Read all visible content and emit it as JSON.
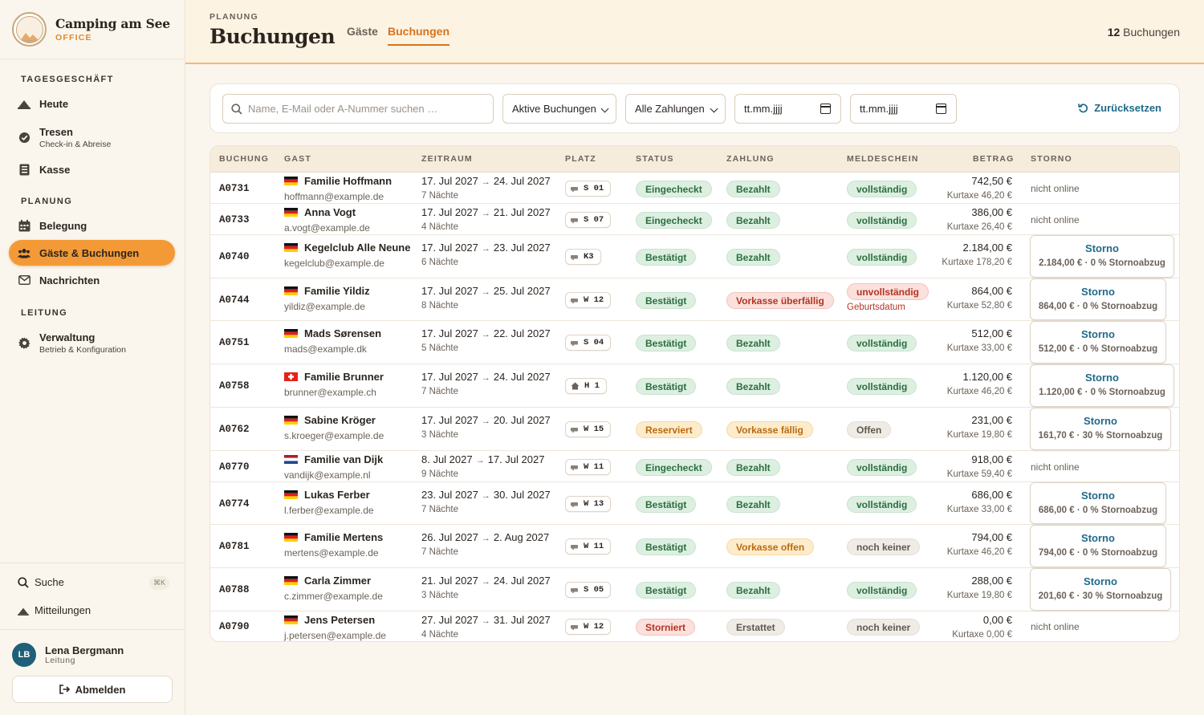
{
  "brand": {
    "name": "Camping am See",
    "sub": "OFFICE"
  },
  "nav": {
    "section1": "TAGESGESCHÄFT",
    "heute": "Heute",
    "tresen": "Tresen",
    "tresen_sub": "Check-in & Abreise",
    "kasse": "Kasse",
    "section2": "PLANUNG",
    "belegung": "Belegung",
    "gaeste": "Gäste & Buchungen",
    "nachrichten": "Nachrichten",
    "section3": "LEITUNG",
    "verwaltung": "Verwaltung",
    "verwaltung_sub": "Betrieb & Konfiguration",
    "suche": "Suche",
    "suche_kbd": "⌘K",
    "mitteilungen": "Mitteilungen"
  },
  "user": {
    "initials": "LB",
    "name": "Lena Bergmann",
    "role": "Leitung",
    "logout": "Abmelden"
  },
  "header": {
    "overline": "PLANUNG",
    "title": "Buchungen",
    "tab1": "Gäste",
    "tab2": "Buchungen",
    "count": "12",
    "count_label": "Buchungen"
  },
  "filters": {
    "search_placeholder": "Name, E-Mail oder A-Nummer suchen …",
    "status": "Aktive Buchungen",
    "payment": "Alle Zahlungen",
    "date_from": "tt.mm.jjjj",
    "date_to": "tt.mm.jjjj",
    "reset": "Zurücksetzen"
  },
  "columns": {
    "buchung": "BUCHUNG",
    "gast": "GAST",
    "zeitraum": "ZEITRAUM",
    "platz": "PLATZ",
    "status": "STATUS",
    "zahlung": "ZAHLUNG",
    "meldeschein": "MELDESCHEIN",
    "betrag": "BETRAG",
    "storno": "STORNO"
  },
  "rows": [
    {
      "id": "A0731",
      "flag": "de",
      "name": "Familie Hoffmann",
      "email": "hoffmann@example.de",
      "from": "17. Jul 2027",
      "to": "24. Jul 2027",
      "nights": "7 Nächte",
      "plot": "S 01",
      "plot_icon": "vehicle-icon",
      "status": "Eingecheckt",
      "status_color": "green",
      "payment": "Bezahlt",
      "payment_color": "green",
      "meldeschein": "vollständig",
      "melde_color": "green",
      "melde_warn": "",
      "amount": "742,50 €",
      "kurtaxe": "Kurtaxe 46,20 €",
      "storno_label": "",
      "storno_detail": "",
      "storno_text": "nicht online"
    },
    {
      "id": "A0733",
      "flag": "de",
      "name": "Anna Vogt",
      "email": "a.vogt@example.de",
      "from": "17. Jul 2027",
      "to": "21. Jul 2027",
      "nights": "4 Nächte",
      "plot": "S 07",
      "plot_icon": "vehicle-icon",
      "status": "Eingecheckt",
      "status_color": "green",
      "payment": "Bezahlt",
      "payment_color": "green",
      "meldeschein": "vollständig",
      "melde_color": "green",
      "melde_warn": "",
      "amount": "386,00 €",
      "kurtaxe": "Kurtaxe 26,40 €",
      "storno_label": "",
      "storno_detail": "",
      "storno_text": "nicht online"
    },
    {
      "id": "A0740",
      "flag": "de",
      "name": "Kegelclub Alle Neune",
      "email": "kegelclub@example.de",
      "from": "17. Jul 2027",
      "to": "23. Jul 2027",
      "nights": "6 Nächte",
      "plot": "K3",
      "plot_icon": "vehicle-icon",
      "status": "Bestätigt",
      "status_color": "green",
      "payment": "Bezahlt",
      "payment_color": "green",
      "meldeschein": "vollständig",
      "melde_color": "green",
      "melde_warn": "",
      "amount": "2.184,00 €",
      "kurtaxe": "Kurtaxe 178,20 €",
      "storno_label": "Storno",
      "storno_detail": "2.184,00 € · 0 % Stornoabzug",
      "storno_text": ""
    },
    {
      "id": "A0744",
      "flag": "de",
      "name": "Familie Yildiz",
      "email": "yildiz@example.de",
      "from": "17. Jul 2027",
      "to": "25. Jul 2027",
      "nights": "8 Nächte",
      "plot": "W 12",
      "plot_icon": "vehicle-icon",
      "status": "Bestätigt",
      "status_color": "green",
      "payment": "Vorkasse überfällig",
      "payment_color": "red",
      "meldeschein": "unvollständig",
      "melde_color": "red",
      "melde_warn": "Geburtsdatum",
      "amount": "864,00 €",
      "kurtaxe": "Kurtaxe 52,80 €",
      "storno_label": "Storno",
      "storno_detail": "864,00 € · 0 % Stornoabzug",
      "storno_text": ""
    },
    {
      "id": "A0751",
      "flag": "de",
      "name": "Mads Sørensen",
      "email": "mads@example.dk",
      "from": "17. Jul 2027",
      "to": "22. Jul 2027",
      "nights": "5 Nächte",
      "plot": "S 04",
      "plot_icon": "vehicle-icon",
      "status": "Bestätigt",
      "status_color": "green",
      "payment": "Bezahlt",
      "payment_color": "green",
      "meldeschein": "vollständig",
      "melde_color": "green",
      "melde_warn": "",
      "amount": "512,00 €",
      "kurtaxe": "Kurtaxe 33,00 €",
      "storno_label": "Storno",
      "storno_detail": "512,00 € · 0 % Stornoabzug",
      "storno_text": ""
    },
    {
      "id": "A0758",
      "flag": "ch",
      "name": "Familie Brunner",
      "email": "brunner@example.ch",
      "from": "17. Jul 2027",
      "to": "24. Jul 2027",
      "nights": "7 Nächte",
      "plot": "H 1",
      "plot_icon": "house-icon",
      "status": "Bestätigt",
      "status_color": "green",
      "payment": "Bezahlt",
      "payment_color": "green",
      "meldeschein": "vollständig",
      "melde_color": "green",
      "melde_warn": "",
      "amount": "1.120,00 €",
      "kurtaxe": "Kurtaxe 46,20 €",
      "storno_label": "Storno",
      "storno_detail": "1.120,00 € · 0 % Stornoabzug",
      "storno_text": ""
    },
    {
      "id": "A0762",
      "flag": "de",
      "name": "Sabine Kröger",
      "email": "s.kroeger@example.de",
      "from": "17. Jul 2027",
      "to": "20. Jul 2027",
      "nights": "3 Nächte",
      "plot": "W 15",
      "plot_icon": "vehicle-icon",
      "status": "Reserviert",
      "status_color": "amber",
      "payment": "Vorkasse fällig",
      "payment_color": "amber",
      "meldeschein": "Offen",
      "melde_color": "gray",
      "melde_warn": "",
      "amount": "231,00 €",
      "kurtaxe": "Kurtaxe 19,80 €",
      "storno_label": "Storno",
      "storno_detail": "161,70 € · 30 % Stornoabzug",
      "storno_text": ""
    },
    {
      "id": "A0770",
      "flag": "nl",
      "name": "Familie van Dijk",
      "email": "vandijk@example.nl",
      "from": "8. Jul 2027",
      "to": "17. Jul 2027",
      "nights": "9 Nächte",
      "plot": "W 11",
      "plot_icon": "vehicle-icon",
      "status": "Eingecheckt",
      "status_color": "green",
      "payment": "Bezahlt",
      "payment_color": "green",
      "meldeschein": "vollständig",
      "melde_color": "green",
      "melde_warn": "",
      "amount": "918,00 €",
      "kurtaxe": "Kurtaxe 59,40 €",
      "storno_label": "",
      "storno_detail": "",
      "storno_text": "nicht online"
    },
    {
      "id": "A0774",
      "flag": "de",
      "name": "Lukas Ferber",
      "email": "l.ferber@example.de",
      "from": "23. Jul 2027",
      "to": "30. Jul 2027",
      "nights": "7 Nächte",
      "plot": "W 13",
      "plot_icon": "vehicle-icon",
      "status": "Bestätigt",
      "status_color": "green",
      "payment": "Bezahlt",
      "payment_color": "green",
      "meldeschein": "vollständig",
      "melde_color": "green",
      "melde_warn": "",
      "amount": "686,00 €",
      "kurtaxe": "Kurtaxe 33,00 €",
      "storno_label": "Storno",
      "storno_detail": "686,00 € · 0 % Stornoabzug",
      "storno_text": ""
    },
    {
      "id": "A0781",
      "flag": "de",
      "name": "Familie Mertens",
      "email": "mertens@example.de",
      "from": "26. Jul 2027",
      "to": "2. Aug 2027",
      "nights": "7 Nächte",
      "plot": "W 11",
      "plot_icon": "vehicle-icon",
      "status": "Bestätigt",
      "status_color": "green",
      "payment": "Vorkasse offen",
      "payment_color": "amber",
      "meldeschein": "noch keiner",
      "melde_color": "gray",
      "melde_warn": "",
      "amount": "794,00 €",
      "kurtaxe": "Kurtaxe 46,20 €",
      "storno_label": "Storno",
      "storno_detail": "794,00 € · 0 % Stornoabzug",
      "storno_text": ""
    },
    {
      "id": "A0788",
      "flag": "de",
      "name": "Carla Zimmer",
      "email": "c.zimmer@example.de",
      "from": "21. Jul 2027",
      "to": "24. Jul 2027",
      "nights": "3 Nächte",
      "plot": "S 05",
      "plot_icon": "vehicle-icon",
      "status": "Bestätigt",
      "status_color": "green",
      "payment": "Bezahlt",
      "payment_color": "green",
      "meldeschein": "vollständig",
      "melde_color": "green",
      "melde_warn": "",
      "amount": "288,00 €",
      "kurtaxe": "Kurtaxe 19,80 €",
      "storno_label": "Storno",
      "storno_detail": "201,60 € · 30 % Stornoabzug",
      "storno_text": ""
    },
    {
      "id": "A0790",
      "flag": "de",
      "name": "Jens Petersen",
      "email": "j.petersen@example.de",
      "from": "27. Jul 2027",
      "to": "31. Jul 2027",
      "nights": "4 Nächte",
      "plot": "W 12",
      "plot_icon": "vehicle-icon",
      "status": "Storniert",
      "status_color": "red",
      "payment": "Erstattet",
      "payment_color": "gray",
      "meldeschein": "noch keiner",
      "melde_color": "gray",
      "melde_warn": "",
      "amount": "0,00 €",
      "kurtaxe": "Kurtaxe 0,00 €",
      "storno_label": "",
      "storno_detail": "",
      "storno_text": "nicht online"
    }
  ],
  "colors": {
    "accent": "#f39a37",
    "link": "#1f6a8a",
    "brand_sub": "#e0892a"
  }
}
